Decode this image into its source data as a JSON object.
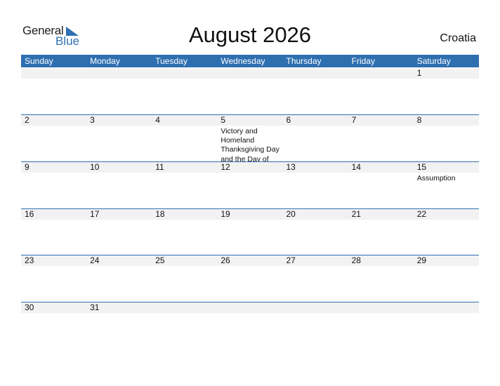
{
  "logo": {
    "line1": "General",
    "line2": "Blue"
  },
  "title": "August 2026",
  "country": "Croatia",
  "colors": {
    "accent": "#2e6fb0",
    "date_strip": "#f2f2f2"
  },
  "weekdays": [
    "Sunday",
    "Monday",
    "Tuesday",
    "Wednesday",
    "Thursday",
    "Friday",
    "Saturday"
  ],
  "weeks": [
    {
      "days": [
        {
          "num": ""
        },
        {
          "num": ""
        },
        {
          "num": ""
        },
        {
          "num": ""
        },
        {
          "num": ""
        },
        {
          "num": ""
        },
        {
          "num": "1"
        }
      ]
    },
    {
      "days": [
        {
          "num": "2"
        },
        {
          "num": "3"
        },
        {
          "num": "4"
        },
        {
          "num": "5",
          "event": "Victory and Homeland Thanksgiving Day and the Day of Croatian Defenders"
        },
        {
          "num": "6"
        },
        {
          "num": "7"
        },
        {
          "num": "8"
        }
      ]
    },
    {
      "days": [
        {
          "num": "9"
        },
        {
          "num": "10"
        },
        {
          "num": "11"
        },
        {
          "num": "12"
        },
        {
          "num": "13"
        },
        {
          "num": "14"
        },
        {
          "num": "15",
          "event": "Assumption"
        }
      ]
    },
    {
      "days": [
        {
          "num": "16"
        },
        {
          "num": "17"
        },
        {
          "num": "18"
        },
        {
          "num": "19"
        },
        {
          "num": "20"
        },
        {
          "num": "21"
        },
        {
          "num": "22"
        }
      ]
    },
    {
      "days": [
        {
          "num": "23"
        },
        {
          "num": "24"
        },
        {
          "num": "25"
        },
        {
          "num": "26"
        },
        {
          "num": "27"
        },
        {
          "num": "28"
        },
        {
          "num": "29"
        }
      ]
    },
    {
      "days": [
        {
          "num": "30"
        },
        {
          "num": "31"
        },
        {
          "num": ""
        },
        {
          "num": ""
        },
        {
          "num": ""
        },
        {
          "num": ""
        },
        {
          "num": ""
        }
      ]
    }
  ]
}
